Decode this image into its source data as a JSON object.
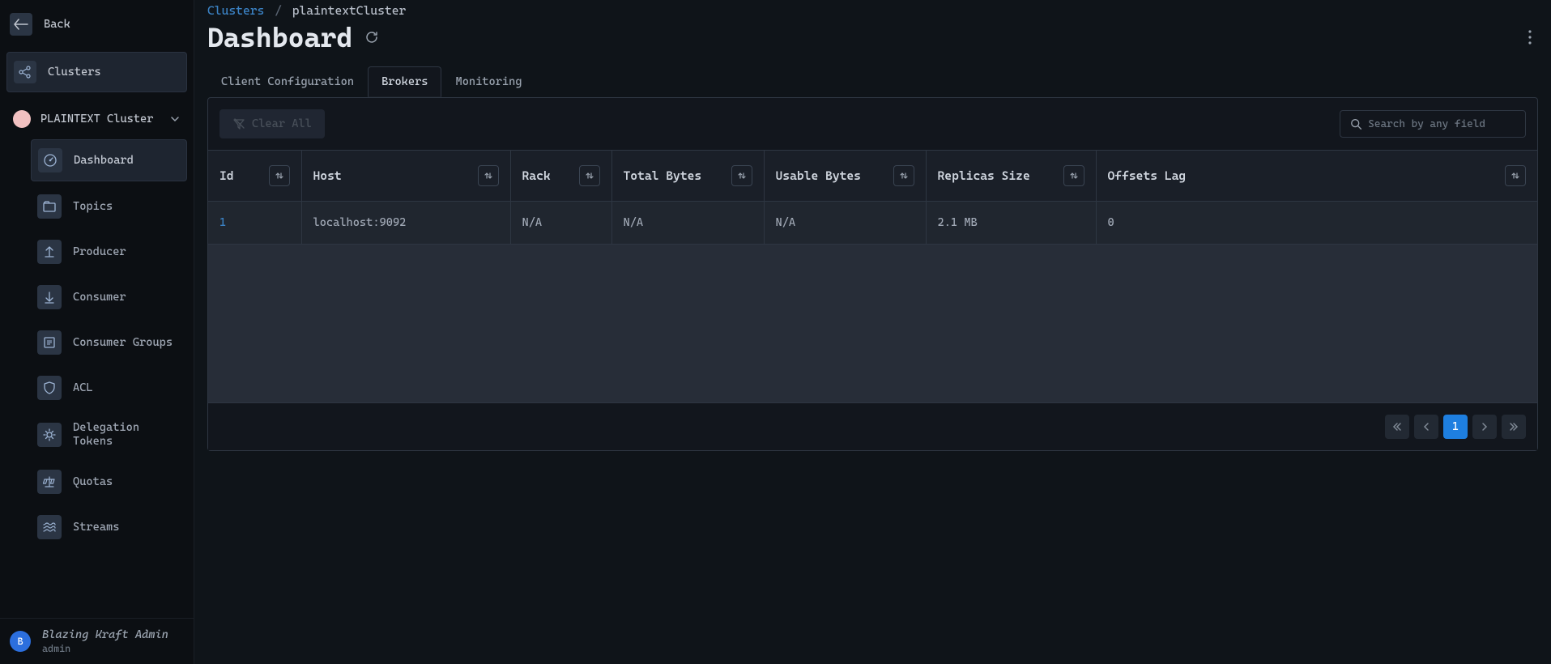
{
  "sidebar": {
    "back_label": "Back",
    "clusters_label": "Clusters",
    "cluster_name": "PLAINTEXT Cluster",
    "items": [
      {
        "label": "Dashboard"
      },
      {
        "label": "Topics"
      },
      {
        "label": "Producer"
      },
      {
        "label": "Consumer"
      },
      {
        "label": "Consumer Groups"
      },
      {
        "label": "ACL"
      },
      {
        "label": "Delegation Tokens"
      },
      {
        "label": "Quotas"
      },
      {
        "label": "Streams"
      }
    ],
    "footer": {
      "avatar_letter": "B",
      "title": "Blazing Kraft Admin",
      "sub": "admin"
    }
  },
  "breadcrumb": {
    "root": "Clusters",
    "sep": "/",
    "current": "plaintextCluster"
  },
  "page": {
    "title": "Dashboard"
  },
  "tabs": [
    {
      "label": "Client Configuration"
    },
    {
      "label": "Brokers"
    },
    {
      "label": "Monitoring"
    }
  ],
  "toolbar": {
    "clear_label": "Clear All",
    "search_placeholder": "Search by any field"
  },
  "table": {
    "columns": [
      "Id",
      "Host",
      "Rack",
      "Total Bytes",
      "Usable Bytes",
      "Replicas Size",
      "Offsets Lag"
    ],
    "rows": [
      {
        "id": "1",
        "host": "localhost:9092",
        "rack": "N/A",
        "total_bytes": "N/A",
        "usable_bytes": "N/A",
        "replicas_size": "2.1 MB",
        "offsets_lag": "0"
      }
    ]
  },
  "pagination": {
    "current": "1"
  }
}
